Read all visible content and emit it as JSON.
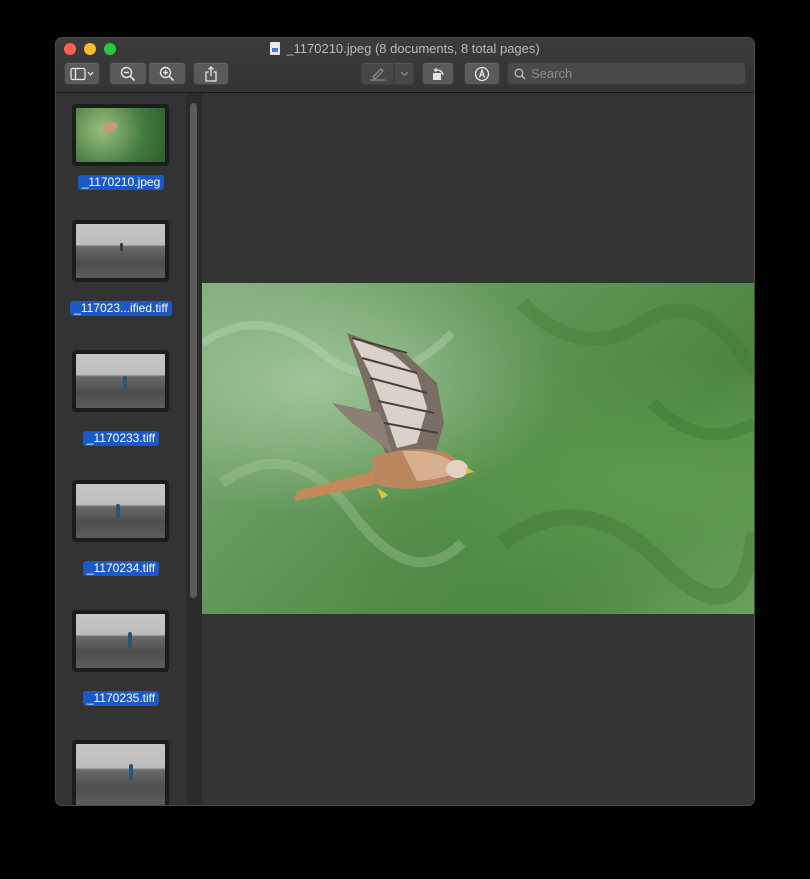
{
  "window": {
    "title": "_1170210.jpeg (8 documents, 8 total pages)"
  },
  "toolbar": {
    "sidebar_toggle_icon": "sidebar-icon",
    "zoom_out_icon": "zoom-out-icon",
    "zoom_in_icon": "zoom-in-icon",
    "share_icon": "share-icon",
    "highlight_icon": "highlighter-icon",
    "rotate_icon": "rotate-left-icon",
    "markup_icon": "markup-pen-icon"
  },
  "search": {
    "placeholder": "Search",
    "value": ""
  },
  "sidebar": {
    "items": [
      {
        "label": "_1170210.jpeg",
        "kind": "bird",
        "selected": true
      },
      {
        "label": "_117023...ified.tiff",
        "kind": "sea",
        "selected": true
      },
      {
        "label": "_1170233.tiff",
        "kind": "sea",
        "selected": true
      },
      {
        "label": "_1170234.tiff",
        "kind": "sea",
        "selected": true
      },
      {
        "label": "_1170235.tiff",
        "kind": "sea",
        "selected": true
      },
      {
        "label": "",
        "kind": "sea",
        "selected": false
      }
    ]
  },
  "colors": {
    "selection": "#1b59c9",
    "close": "#ff5f57",
    "minimize": "#febc2e",
    "maximize": "#28c840"
  }
}
